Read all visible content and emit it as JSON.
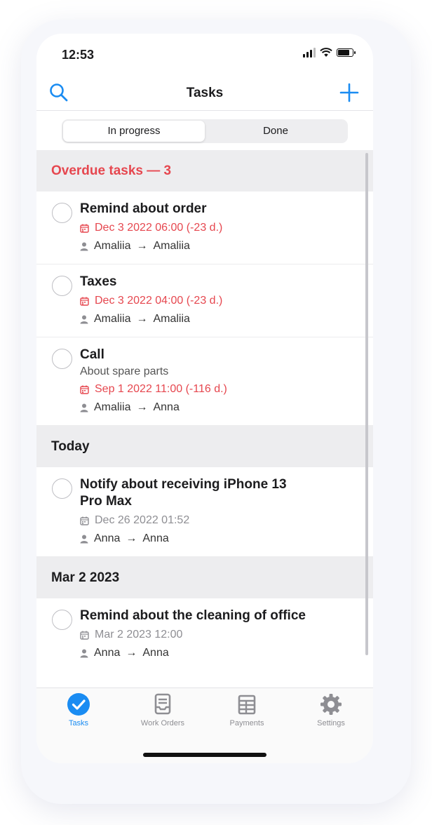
{
  "status_bar": {
    "time": "12:53"
  },
  "nav": {
    "title": "Tasks"
  },
  "segments": [
    {
      "label": "In progress",
      "active": true
    },
    {
      "label": "Done",
      "active": false
    }
  ],
  "sections": [
    {
      "title": "Overdue tasks — 3",
      "overdue": true,
      "tasks": [
        {
          "title": "Remind about order",
          "date": "Dec 3 2022 06:00 (-23 d.)",
          "from": "Amaliia",
          "to": "Amaliia"
        },
        {
          "title": "Taxes",
          "date": "Dec 3 2022 04:00 (-23 d.)",
          "from": "Amaliia",
          "to": "Amaliia"
        },
        {
          "title": "Call",
          "note": "About spare parts",
          "date": "Sep 1 2022 11:00 (-116 d.)",
          "from": "Amaliia",
          "to": "Anna"
        }
      ]
    },
    {
      "title": "Today",
      "overdue": false,
      "tasks": [
        {
          "title": "Notify about receiving iPhone 13 Pro Max",
          "date": "Dec 26 2022 01:52",
          "from": "Anna",
          "to": "Anna"
        }
      ]
    },
    {
      "title": "Mar 2 2023",
      "overdue": false,
      "tasks": [
        {
          "title": "Remind about the cleaning of office",
          "date": "Mar 2 2023 12:00",
          "from": "Anna",
          "to": "Anna"
        }
      ]
    }
  ],
  "tabs": [
    {
      "label": "Tasks",
      "icon": "checkmark-circle-icon",
      "active": true
    },
    {
      "label": "Work Orders",
      "icon": "work-orders-icon",
      "active": false
    },
    {
      "label": "Payments",
      "icon": "payments-icon",
      "active": false
    },
    {
      "label": "Settings",
      "icon": "gear-icon",
      "active": false
    }
  ],
  "colors": {
    "accent": "#1a8cf2",
    "overdue": "#e6474f"
  }
}
